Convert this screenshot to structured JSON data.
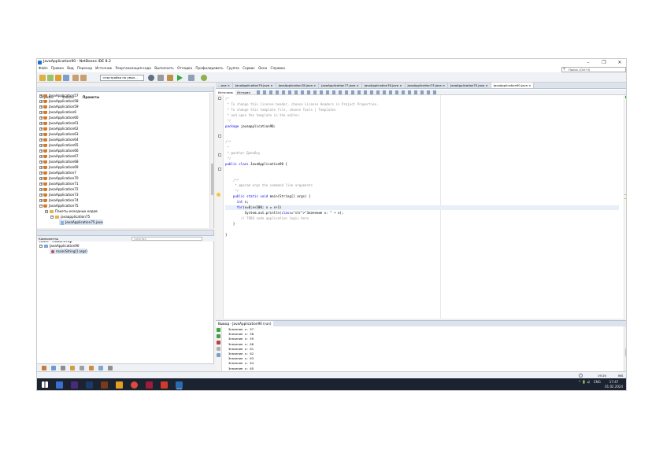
{
  "window": {
    "title": "JavaApplication90 - NetBeans IDE 8.2",
    "controls": [
      "–",
      "❐",
      "✕"
    ]
  },
  "menu": [
    "Файл",
    "Правка",
    "Вид",
    "Переход",
    "Источник",
    "Реорганизация кода",
    "Выполнить",
    "Отладка",
    "Профилировать",
    "Группа",
    "Сервис",
    "Окно",
    "Справка"
  ],
  "search": {
    "placeholder": "Поиск (Ctrl+I)"
  },
  "toolbar": {
    "config": "<настройка по умол..."
  },
  "left_tabs": [
    "Службы",
    "Файлы",
    "Проекты"
  ],
  "projects": {
    "items": [
      "JavaApplication57",
      "JavaApplication58",
      "JavaApplication59",
      "JavaApplication6",
      "JavaApplication60",
      "JavaApplication61",
      "JavaApplication62",
      "JavaApplication63",
      "JavaApplication64",
      "JavaApplication65",
      "JavaApplication66",
      "JavaApplication67",
      "JavaApplication68",
      "JavaApplication69",
      "JavaApplication7",
      "JavaApplication70",
      "JavaApplication71",
      "JavaApplication72",
      "JavaApplication73",
      "JavaApplication74",
      "JavaApplication75"
    ],
    "source_pkg": "Пакеты исходных кодов",
    "package": "javaapplication75",
    "file": "JavaApplication75.java"
  },
  "navigator": {
    "title": "main - Навигатор",
    "filter_label": "Компоненты",
    "filter_value": "<пусто>",
    "class": "JavaApplication90",
    "method": "main(String[] args)"
  },
  "file_tabs": [
    "...ava",
    "JavaApplication79.java",
    "JavaApplication78.java",
    "JavaApplication77.java",
    "JavaApplication76.java",
    "JavaApplication73.java",
    "JavaApplication75.java",
    "JavaApplication90.java"
  ],
  "editor_tabs": [
    "Источник",
    "История"
  ],
  "code": [
    {
      "t": "/*",
      "c": "cm"
    },
    {
      "t": " * To change this license header, choose License Headers in Project Properties.",
      "c": "cm"
    },
    {
      "t": " * To change this template file, choose Tools | Templates",
      "c": "cm"
    },
    {
      "t": " * and open the template in the editor.",
      "c": "cm"
    },
    {
      "t": " */",
      "c": "cm"
    },
    {
      "t": "package javaapplication90;",
      "c": ""
    },
    {
      "t": "",
      "c": ""
    },
    {
      "t": "",
      "c": ""
    },
    {
      "t": "/**",
      "c": "cm"
    },
    {
      "t": " *",
      "c": "cm"
    },
    {
      "t": " * @author Долобоу",
      "c": "cm"
    },
    {
      "t": " */",
      "c": "cm"
    },
    {
      "t": "public class JavaApplication90 {",
      "c": ""
    },
    {
      "t": "",
      "c": ""
    },
    {
      "t": "",
      "c": ""
    },
    {
      "t": "    /**",
      "c": "cm"
    },
    {
      "t": "     * @param args the command line arguments",
      "c": "cm"
    },
    {
      "t": "     */",
      "c": "cm"
    },
    {
      "t": "    public static void main(String[] args) {",
      "c": ""
    },
    {
      "t": "      int x;",
      "c": ""
    },
    {
      "t": "      for(x=0;x<100; x = x+1)",
      "c": "hl"
    },
    {
      "t": "          System.out.println(\"Значение x: \" + x);",
      "c": ""
    },
    {
      "t": "        // TODO code application logic here",
      "c": "cm"
    },
    {
      "t": "    }",
      "c": ""
    },
    {
      "t": "",
      "c": ""
    },
    {
      "t": "}",
      "c": ""
    }
  ],
  "output": {
    "title": "Вывод - JavaApplication90 (run)",
    "lines": [
      "Значение x: 57",
      "Значение x: 58",
      "Значение x: 59",
      "Значение x: 60",
      "Значение x: 61",
      "Значение x: 62",
      "Значение x: 63",
      "Значение x: 64",
      "Значение x: 65"
    ]
  },
  "status": {
    "position": "19:20",
    "mode": "INS"
  },
  "tray": {
    "lang": "ENG",
    "time": "17:47",
    "date": "01.02.2024"
  }
}
